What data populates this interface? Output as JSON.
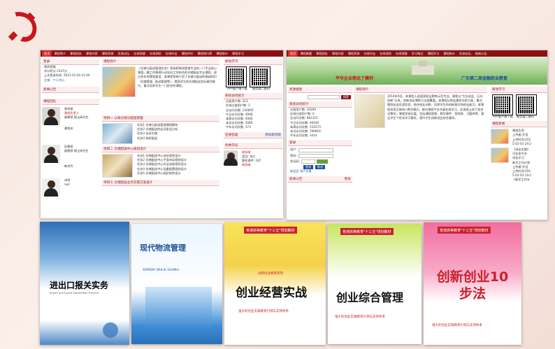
{
  "left_site": {
    "nav": [
      "首页",
      "课程简介",
      "课程团队",
      "课程内容",
      "课程资源",
      "交流论坛",
      "在线答疑",
      "在线测验",
      "在线作业",
      "课程评价",
      "课程排行榜",
      "课程统计",
      "课程学习"
    ],
    "login": {
      "title": "登录",
      "lines": [
        "胡忻招喻",
        "学分积分:1547分",
        "上次登录时间: 2021-01-04 22:44",
        "注销　个人中心"
      ]
    },
    "news_title": "新闻公告",
    "team": {
      "title": "课程团队",
      "members": [
        {
          "name": "胡忻喻",
          "role": "课程负责人",
          "detail": "副教授 硕士研究生"
        },
        {
          "name": "谭男岸",
          "role": "",
          "detail": ""
        },
        {
          "name": "彭教授",
          "role": "",
          "detail": "副教授 硕士研究生"
        },
        {
          "name": "韩洪竹",
          "role": "",
          "detail": ""
        },
        {
          "name": "讲师",
          "role": "",
          "detail": "null"
        }
      ]
    },
    "intro": {
      "title": "课程简介",
      "text": "《仓储与配送管理实务》是高职物流管理专业的一门专业核心课程。属工作情境行动导向工学结合的仓储配送专业课程，经过多年的课程建设，本课程系统介绍了仓储与配送的基础知识（仓储管理、配送管理等），提高学生的仓储配送实际操作能力，重点培养学生一门综合性课程。"
    },
    "project1": {
      "title": "项目一 认知仓储与配送管理",
      "items": [
        "任务1 仓储与配送管理课程解构",
        "任务2 仓储配送的业及职业分析",
        "任务3 走进仓储",
        "任务4 体验配送"
      ]
    },
    "project2": {
      "title": "项目二 仓储配送中心规划设计",
      "items": [
        "任务1 仓储配送中心选址规划设计",
        "任务2 仓储配送中心平面布局规划设计",
        "任务3 仓储配送中心作业流程规划设计",
        "任务4 仓储配送中心设备配置规划设计",
        "任务5 仓储配送中心组织结构设计"
      ]
    },
    "project3_title": "项目三 仓储配送业务实施方案设计",
    "study": {
      "title": "移动学习",
      "labels": [
        "APP客户端下载",
        "服务器二维码"
      ]
    },
    "stats": {
      "title": "系统访问统计",
      "lines": [
        "注册用户数: 313",
        "在线注册用户数: 2",
        "总访问次数: 120605",
        "今日访问次数: 4066",
        "本周访问次数: 4066",
        "本月访问次数: 5085",
        "今年访问次数: 373"
      ]
    },
    "forum": {
      "title": "在线答疑",
      "more": "添加新问题"
    },
    "excellent": {
      "title": "优秀学员",
      "lines": [
        "胡忻喻",
        "翌回: 张三",
        "题拓课件: 187",
        "胡忻喻"
      ]
    }
  },
  "right_site": {
    "nav": [
      "首页",
      "课程概要",
      "课程团队",
      "课程内容",
      "课程资源",
      "在线作业",
      "在线测验",
      "在线答疑",
      "学习笔记",
      "课程学习",
      "课程统计",
      "交流论坛",
      "新闻公告"
    ],
    "banner_left": "平华企业简论了模刑",
    "banner_right": "广东第二类金融职业教育",
    "resource_title": "资源搜索",
    "search_button": "搜索",
    "stats": {
      "title": "系统访问统计",
      "lines": [
        "注册用户数: 10209",
        "在线注册用户数: 0",
        "总访问次数: 881310",
        "今日访问次数: 40030",
        "本周访问次数: 152573",
        "本月访问次数: 799604",
        "今年访问次数: 3414"
      ]
    },
    "login": {
      "title": "登录",
      "fields": [
        "用户:",
        "密码:",
        "验证码:"
      ],
      "buttons": [
        "登录",
        "取消"
      ],
      "links": "新会员 用户注册"
    },
    "news": {
      "title": "新闻公告",
      "more": "更多"
    },
    "intro": {
      "title": "课程简介",
      "text": "2014年9月，本课程入选国家职业教育示范专业，课程以\"大众创业、万众创新\"以来，创新创业课程已全面覆盖。本课程从职业素质培养方面，重点围绕创业实战项目，结合创业训练，培养学生的创新意识和创业能力。本课程采用互联网+教学模式，依托课程平台开展在线学习，实现线上线下混合式教学。课程资源丰富，包括课程视频、教学课件、案例库、习题库等，满足学生个性化学习需求，提升学生创新创业综合素质。"
    },
    "study": {
      "title": "移动学习",
      "labels": [
        "APP客户端下载",
        "服务器二维码"
      ]
    },
    "news_right": {
      "title": "课程新闻",
      "lines": [
        "课程负责",
        "上传者:开设",
        "上传时间:202",
        "5-02-03 19:2",
        "《创业实操》",
        "可在本平台",
        "浏览学习",
        "新学工作计划",
        "上传者:开设",
        "上传时间:202",
        "5-02-03 19:2",
        "《新学工作计"
      ]
    }
  },
  "books": [
    {
      "title": "进出口报关实务",
      "subtitle": "Import and Export Declaration Practice"
    },
    {
      "title": "现代物流管理",
      "subtitle": "XIANDAI WULIU GUANLI"
    },
    {
      "title": "创业经营实战",
      "ribbon": "普通高等教育\"十三五\"规划教材",
      "tag": "创新创业教育系列",
      "slogan": "强大的创业实践教育引领与支持体系"
    },
    {
      "title": "创业综合管理",
      "ribbon": "普通高等教育\"十三五\"规划教材",
      "slogan": "强大的创业实践教育引领与支持体系"
    },
    {
      "title": "创新创业10步法",
      "ribbon": "普通高等教育\"十三五\"规划教材",
      "slogan": "强大的创业实践教育引领与支持体系"
    }
  ],
  "colors": {
    "nav_red": "#8c0f14",
    "accent_red": "#c11111",
    "party_red": "#c8161d"
  }
}
